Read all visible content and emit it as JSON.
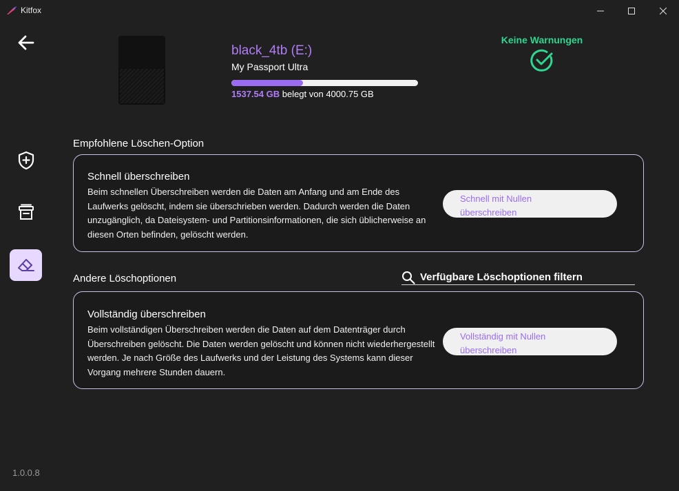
{
  "window": {
    "title": "Kitfox",
    "controls": [
      "minimize-icon",
      "maximize-icon",
      "close-icon"
    ]
  },
  "sidebar": {
    "back_icon": "arrow-left-icon",
    "items": [
      {
        "icon": "shield-plus-icon",
        "active": false
      },
      {
        "icon": "archive-box-icon",
        "active": false
      },
      {
        "icon": "eraser-icon",
        "active": true
      }
    ],
    "version": "1.0.0.8"
  },
  "drive": {
    "name": "black_4tb (E:)",
    "model": "My Passport Ultra",
    "used": "1537.54 GB",
    "used_suffix": " belegt von 4000.75 GB",
    "used_fraction": 0.3843
  },
  "status": {
    "text": "Keine Warnungen",
    "icon": "check-circle-icon",
    "color": "#2ed68f"
  },
  "recommended": {
    "section_title": "Empfohlene Löschen-Option",
    "card": {
      "title": "Schnell überschreiben",
      "description": "Beim schnellen Überschreiben werden die Daten am Anfang und am Ende des Laufwerks gelöscht, indem sie überschrieben werden. Dadurch werden die Daten unzugänglich, da Dateisystem- und Partitionsinformationen, die sich üblicherweise an diesen Orten befinden, gelöscht werden.",
      "button_line1": "Schnell mit Nullen",
      "button_line2": "überschreiben"
    }
  },
  "other": {
    "section_title": "Andere Löschoptionen",
    "filter_placeholder": "Verfügbare Löschoptionen filtern",
    "card": {
      "title": "Vollständig überschreiben",
      "description": "Beim vollständigen Überschreiben werden die Daten auf dem Datenträger durch Überschreiben gelöscht. Die Daten werden gelöscht und können nicht wiederhergestellt werden. Je nach Größe des Laufwerks und der Leistung des Systems kann dieser Vorgang mehrere Stunden dauern.",
      "button_line1": "Vollständig mit Nullen",
      "button_line2": "überschreiben"
    }
  },
  "colors": {
    "accent": "#9a6cf1",
    "accent_text": "#b07cf7",
    "background": "#202020",
    "card_border": "#c9c2e8"
  }
}
